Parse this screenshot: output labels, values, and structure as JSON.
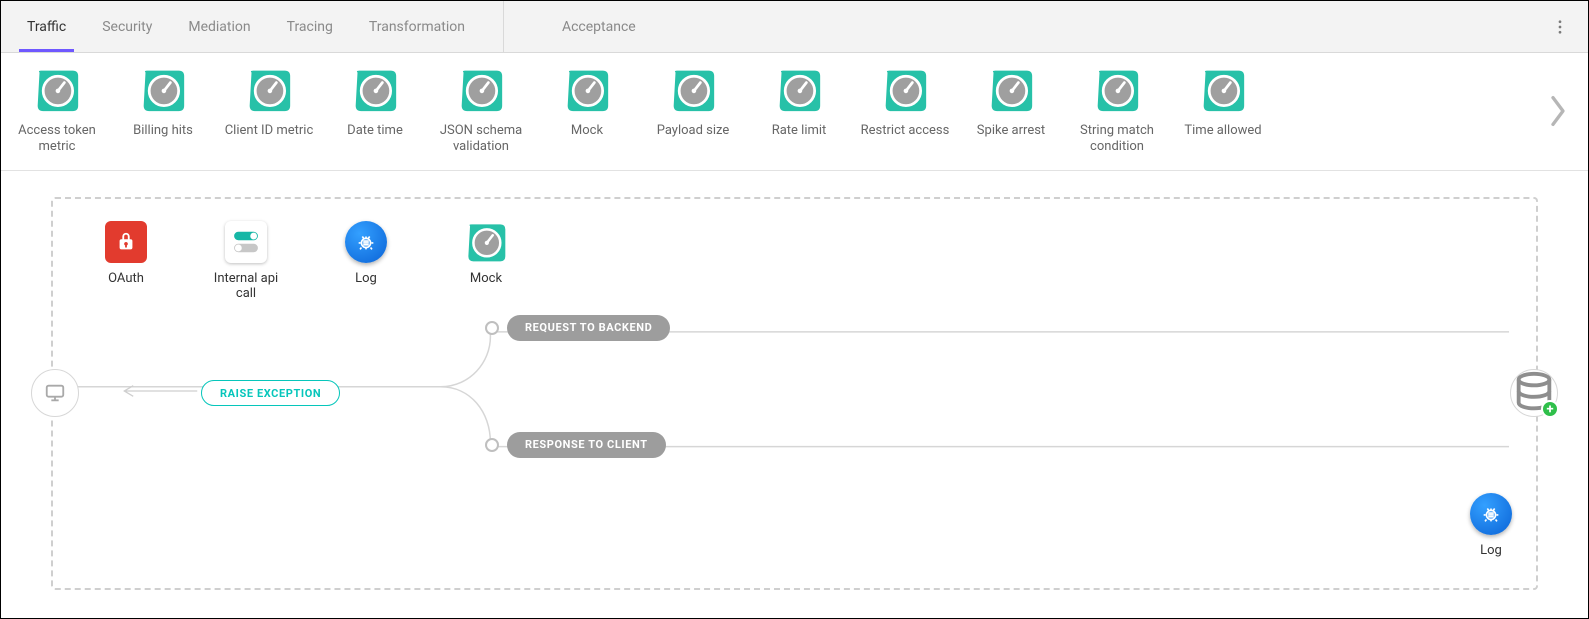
{
  "tabs": {
    "primary": [
      {
        "label": "Traffic",
        "active": true
      },
      {
        "label": "Security",
        "active": false
      },
      {
        "label": "Mediation",
        "active": false
      },
      {
        "label": "Tracing",
        "active": false
      },
      {
        "label": "Transformation",
        "active": false
      }
    ],
    "secondary": [
      {
        "label": "Acceptance",
        "active": false
      }
    ]
  },
  "palette": [
    {
      "label": "Access token metric"
    },
    {
      "label": "Billing hits"
    },
    {
      "label": "Client ID metric"
    },
    {
      "label": "Date time"
    },
    {
      "label": "JSON schema validation"
    },
    {
      "label": "Mock"
    },
    {
      "label": "Payload size"
    },
    {
      "label": "Rate limit"
    },
    {
      "label": "Restrict access"
    },
    {
      "label": "Spike arrest"
    },
    {
      "label": "String match condition"
    },
    {
      "label": "Time allowed"
    }
  ],
  "flow": {
    "request_policies": [
      {
        "label": "OAuth",
        "kind": "oauth"
      },
      {
        "label": "Internal api call",
        "kind": "internal"
      },
      {
        "label": "Log",
        "kind": "log"
      },
      {
        "label": "Mock",
        "kind": "gauge"
      }
    ],
    "response_policies": [
      {
        "label": "Log",
        "kind": "log"
      }
    ],
    "labels": {
      "request_to_backend": "REQUEST TO BACKEND",
      "response_to_client": "RESPONSE TO CLIENT",
      "raise_exception": "RAISE EXCEPTION"
    }
  },
  "colors": {
    "accent": "#06c6bb",
    "tab_indicator": "#6f58ff",
    "pill_gray": "#9d9d9d"
  }
}
